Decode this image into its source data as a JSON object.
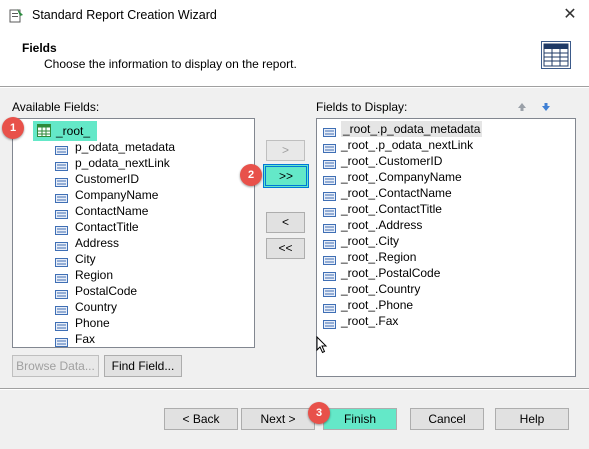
{
  "window": {
    "title": "Standard Report Creation Wizard",
    "close_glyph": "✕"
  },
  "header": {
    "title": "Fields",
    "subtitle": "Choose the information to display on the report."
  },
  "available": {
    "label": "Available Fields:",
    "root": "_root_",
    "items": [
      "p_odata_metadata",
      "p_odata_nextLink",
      "CustomerID",
      "CompanyName",
      "ContactName",
      "ContactTitle",
      "Address",
      "City",
      "Region",
      "PostalCode",
      "Country",
      "Phone",
      "Fax"
    ]
  },
  "display": {
    "label": "Fields to Display:",
    "items": [
      "_root_.p_odata_metadata",
      "_root_.p_odata_nextLink",
      "_root_.CustomerID",
      "_root_.CompanyName",
      "_root_.ContactName",
      "_root_.ContactTitle",
      "_root_.Address",
      "_root_.City",
      "_root_.Region",
      "_root_.PostalCode",
      "_root_.Country",
      "_root_.Phone",
      "_root_.Fax"
    ]
  },
  "move_buttons": {
    "add": ">",
    "add_all": ">>",
    "remove": "<",
    "remove_all": "<<"
  },
  "browse_data_label": "Browse Data...",
  "find_field_label": "Find Field...",
  "footer": {
    "back": "< Back",
    "next": "Next >",
    "finish": "Finish",
    "cancel": "Cancel",
    "help": "Help"
  },
  "badges": {
    "one": "1",
    "two": "2",
    "three": "3"
  },
  "colors": {
    "highlight": "#64e8c8",
    "badge": "#e8514a",
    "focus_border": "#0078d7"
  }
}
